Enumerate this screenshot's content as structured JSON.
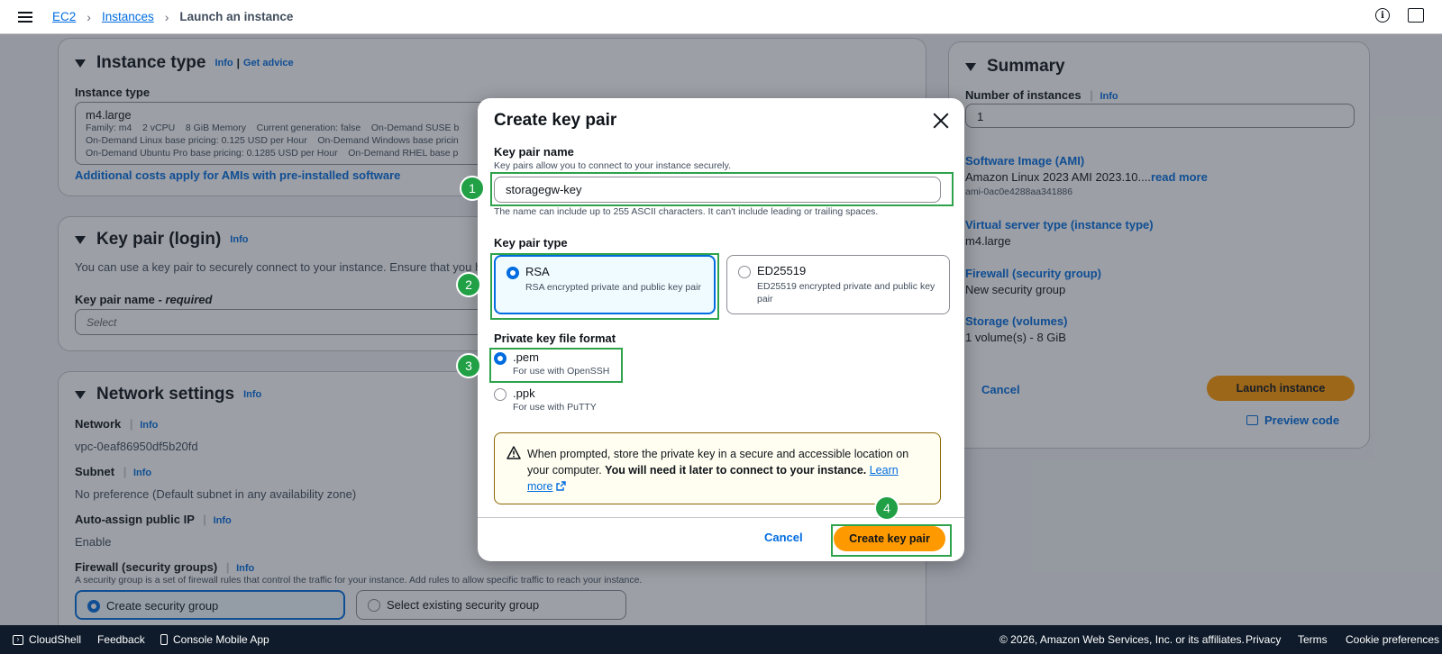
{
  "breadcrumb": {
    "ec2": "EC2",
    "instances": "Instances",
    "current": "Launch an instance"
  },
  "icons": {
    "menu": "hamburger-icon",
    "info": "info-icon",
    "feedback": "feedback-icon"
  },
  "instance_type": {
    "title": "Instance type",
    "info": "Info",
    "get_advice": "Get advice",
    "label": "Instance type",
    "name": "m4.large",
    "line1": "Family: m4    2 vCPU    8 GiB Memory    Current generation: false    On-Demand SUSE b",
    "line2": "On-Demand Linux base pricing: 0.125 USD per Hour    On-Demand Windows base pricin",
    "line3": "On-Demand Ubuntu Pro base pricing: 0.1285 USD per Hour    On-Demand RHEL base p",
    "additional_costs": "Additional costs apply for AMIs with pre-installed software"
  },
  "key_pair_section": {
    "title": "Key pair (login)",
    "info": "Info",
    "desc": "You can use a key pair to securely connect to your instance. Ensure that you ha",
    "label": "Key pair name",
    "required": "- required",
    "placeholder": "Select"
  },
  "network": {
    "title": "Network settings",
    "info": "Info",
    "network_label": "Network",
    "network_value": "vpc-0eaf86950df5b20fd",
    "subnet_label": "Subnet",
    "subnet_value": "No preference (Default subnet in any availability zone)",
    "public_ip_label": "Auto-assign public IP",
    "public_ip_value": "Enable",
    "firewall_label": "Firewall (security groups)",
    "firewall_desc": "A security group is a set of firewall rules that control the traffic for your instance. Add rules to allow specific traffic to reach your instance.",
    "create_sg": "Create security group",
    "select_sg": "Select existing security group"
  },
  "summary": {
    "title": "Summary",
    "num_label": "Number of instances",
    "info": "Info",
    "num_value": "1",
    "ami_label": "Software Image (AMI)",
    "ami_value": "Amazon Linux 2023 AMI 2023.10....",
    "read_more": "read more",
    "ami_id": "ami-0ac0e4288aa341886",
    "vst_label": "Virtual server type (instance type)",
    "vst_value": "m4.large",
    "fw_label": "Firewall (security group)",
    "fw_value": "New security group",
    "storage_label": "Storage (volumes)",
    "storage_value": "1 volume(s) - 8 GiB",
    "cancel": "Cancel",
    "launch": "Launch instance",
    "preview": "Preview code"
  },
  "modal": {
    "title": "Create key pair",
    "name_label": "Key pair name",
    "name_desc": "Key pairs allow you to connect to your instance securely.",
    "name_value": "storagegw-key",
    "name_constraint": "The name can include up to 255 ASCII characters. It can't include leading or trailing spaces.",
    "type_label": "Key pair type",
    "rsa_title": "RSA",
    "rsa_desc": "RSA encrypted private and public key pair",
    "ed_title": "ED25519",
    "ed_desc": "ED25519 encrypted private and public key pair",
    "format_label": "Private key file format",
    "pem_title": ".pem",
    "pem_desc": "For use with OpenSSH",
    "ppk_title": ".ppk",
    "ppk_desc": "For use with PuTTY",
    "alert_text": "When prompted, store the private key in a secure and accessible location on your computer. ",
    "alert_bold": "You will need it later to connect to your instance.",
    "learn_more": "Learn more",
    "cancel": "Cancel",
    "create": "Create key pair"
  },
  "annotations": {
    "b1": "1",
    "b2": "2",
    "b3": "3",
    "b4": "4"
  },
  "footer": {
    "cloudshell": "CloudShell",
    "feedback": "Feedback",
    "mobile": "Console Mobile App",
    "copyright": "© 2026, Amazon Web Services, Inc. or its affiliates.",
    "privacy": "Privacy",
    "terms": "Terms",
    "cookies": "Cookie preferences"
  }
}
